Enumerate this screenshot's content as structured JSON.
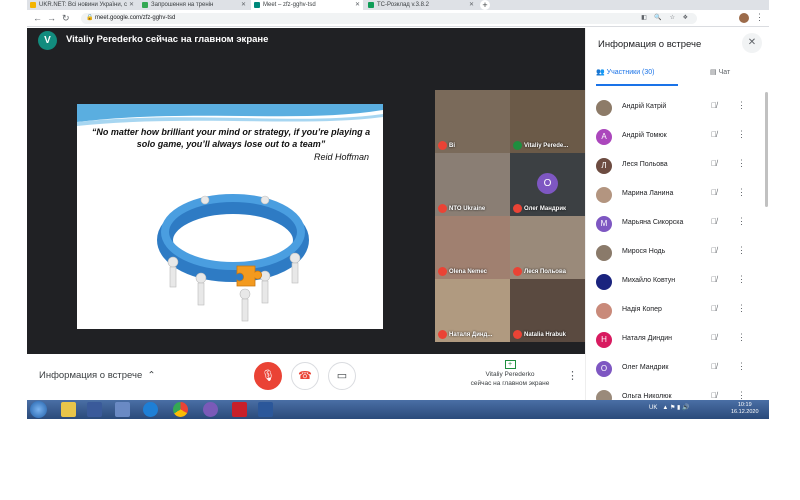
{
  "browser": {
    "tabs": [
      {
        "title": "UKR.NET: Всі новини України, с",
        "fav_color": "#f4b400"
      },
      {
        "title": "Запрошення на тренін",
        "fav_color": "#34a853"
      },
      {
        "title": "Meet – zfz-gghv-tsd",
        "fav_color": "#00897b",
        "active": true
      },
      {
        "title": "ТС-Розклад v.3.8.2",
        "fav_color": "#0f9d58"
      }
    ],
    "new_tab": "+",
    "url": "meet.google.com/zfz-gghv-tsd",
    "back": "←",
    "forward": "→",
    "reload": "↻",
    "menu": "⋮",
    "omni_icons": "◧ 🔍 ☆ ❖"
  },
  "meet": {
    "presenter_initial": "V",
    "presenter_text": "Vitaliy Perederko сейчас на главном экране",
    "slide": {
      "quote": "“No matter how brilliant your mind or strategy, if you’re playing a solo game, you’ll always lose out to a team”",
      "author": "Reid Hoffman"
    },
    "tiles": [
      {
        "name": "Ві",
        "muted": true,
        "bg": "#7a6a5a"
      },
      {
        "name": "Vitaliy Peredе...",
        "muted": false,
        "bg": "#6b5a48"
      },
      {
        "name": "NTO Ukraine",
        "muted": true,
        "bg": "#8a7e74"
      },
      {
        "name": "Олег Мандрик",
        "muted": true,
        "bg": "#3c4043",
        "initial": "О"
      },
      {
        "name": "Olena Nemec",
        "muted": true,
        "bg": "#a08070"
      },
      {
        "name": "Леся Польова",
        "muted": true,
        "bg": "#9a8a7a"
      },
      {
        "name": "Наталя Динд...",
        "muted": true,
        "bg": "#b09a80"
      },
      {
        "name": "Natalia Hrabuk",
        "muted": true,
        "bg": "#5a4a40"
      }
    ],
    "meeting_info_label": "Информация о встрече",
    "present_line1": "Vitaliy Perederko",
    "present_line2": "сейчас на главном экране"
  },
  "panel": {
    "title": "Информация о встрече",
    "close": "✕",
    "tab_people": "Участники (30)",
    "tab_chat": "Чат",
    "participants": [
      {
        "name": "Андрій Катрій",
        "initial": "",
        "color": "#8d7b68",
        "photo": true
      },
      {
        "name": "Андрій Томюк",
        "initial": "А",
        "color": "#ab47bc"
      },
      {
        "name": "Леся Польова",
        "initial": "Л",
        "color": "#6d4c41"
      },
      {
        "name": "Марина Ланина",
        "initial": "",
        "color": "#b39580",
        "photo": true
      },
      {
        "name": "Марьяна Сикорска",
        "initial": "М",
        "color": "#7e57c2"
      },
      {
        "name": "Мирося Нодь",
        "initial": "",
        "color": "#8a7a6a",
        "photo": true
      },
      {
        "name": "Михайло Ковтун",
        "initial": "",
        "color": "#1a237e",
        "photo": true
      },
      {
        "name": "Надія Копер",
        "initial": "",
        "color": "#c98a7a",
        "photo": true
      },
      {
        "name": "Наталя Диндин",
        "initial": "Н",
        "color": "#d81b60"
      },
      {
        "name": "Олег Мандрик",
        "initial": "О",
        "color": "#7e57c2"
      },
      {
        "name": "Ольга Николюк",
        "initial": "",
        "color": "#9a8a7a",
        "photo": true
      }
    ]
  },
  "taskbar": {
    "tray_lang": "UK",
    "time": "10:19",
    "date": "16.12.2020"
  },
  "colors": {
    "accent": "#1a73e8",
    "end_call": "#ea4335",
    "stage_bg": "#202124"
  }
}
